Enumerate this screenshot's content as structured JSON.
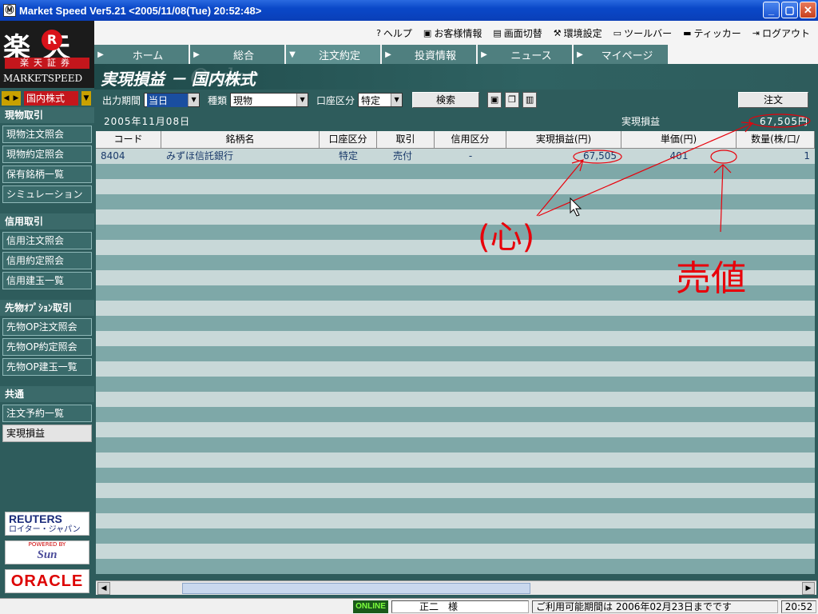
{
  "window": {
    "title": "Market Speed Ver5.21 <2005/11/08(Tue) 20:52:48>",
    "minimize": "_",
    "maximize": "▢",
    "close": "✕"
  },
  "logo": {
    "kanji": "楽 天",
    "r": "R",
    "subtitle": "楽天証券",
    "product": "MARKETSPEED"
  },
  "market_selector": {
    "prev": "◀",
    "next": "▶",
    "value": "国内株式",
    "dropdown": "▼"
  },
  "sidebar": {
    "sections": [
      {
        "title": "現物取引",
        "items": [
          "現物注文照会",
          "現物約定照会",
          "保有銘柄一覧",
          "シミュレーション"
        ]
      },
      {
        "title": "信用取引",
        "items": [
          "信用注文照会",
          "信用約定照会",
          "信用建玉一覧"
        ]
      },
      {
        "title": "先物ｵﾌﾟｼｮﾝ取引",
        "items": [
          "先物OP注文照会",
          "先物OP約定照会",
          "先物OP建玉一覧"
        ]
      },
      {
        "title": "共通",
        "items": [
          "注文予約一覧",
          "実現損益"
        ]
      }
    ],
    "active_item": "実現損益"
  },
  "sponsors": {
    "reuters": "REUTERS",
    "reuters_sub": "ロイター・ジャパン",
    "sun_powered": "POWERED BY",
    "sun": "Sun",
    "oracle": "ORACLE"
  },
  "toplinks": [
    {
      "icon": "?",
      "label": "ヘルプ"
    },
    {
      "icon": "▣",
      "label": "お客様情報"
    },
    {
      "icon": "▤",
      "label": "画面切替"
    },
    {
      "icon": "⚒",
      "label": "環境設定"
    },
    {
      "icon": "▭",
      "label": "ツールバー"
    },
    {
      "icon": "▬",
      "label": "ティッカー"
    },
    {
      "icon": "⇥",
      "label": "ログアウト"
    }
  ],
  "tabs": [
    {
      "label": "ホーム",
      "active": false
    },
    {
      "label": "総合",
      "active": false
    },
    {
      "label": "注文約定",
      "active": true
    },
    {
      "label": "投資情報",
      "active": false
    },
    {
      "label": "ニュース",
      "active": false
    },
    {
      "label": "マイページ",
      "active": false
    }
  ],
  "page": {
    "title": "実現損益 － 国内株式",
    "ghost": "Order"
  },
  "toolbar": {
    "period_label": "出力期間",
    "period_value": "当日",
    "type_label": "種類",
    "type_value": "現物",
    "account_label": "口座区分",
    "account_value": "特定",
    "search_button": "検索",
    "order_button": "注文",
    "save_icon": "▣",
    "copy_icon": "❐",
    "chart_icon": "▥"
  },
  "summary": {
    "date": "2005年11月08日",
    "total_label": "実現損益",
    "total_value": "67,505円"
  },
  "table": {
    "columns": [
      "コード",
      "銘柄名",
      "口座区分",
      "取引",
      "信用区分",
      "実現損益(円)",
      "単価(円)",
      "数量(株/口/"
    ],
    "rows": [
      {
        "code": "8404",
        "name": "みずほ信託銀行",
        "account": "特定",
        "trade": "売付",
        "margin": "-",
        "pnl": "67,505",
        "price": "401",
        "qty": "1"
      }
    ]
  },
  "annotations": {
    "left_note": "(心)",
    "right_note": "売値"
  },
  "status": {
    "online": "ONLINE",
    "user": "正二　様",
    "period": "ご利用可能期間は 2006年02月23日までです",
    "clock": "20:52"
  },
  "colors": {
    "annotation": "#e8000a",
    "row_dark": "#7ea8a8",
    "row_light": "#c8d8d8"
  }
}
